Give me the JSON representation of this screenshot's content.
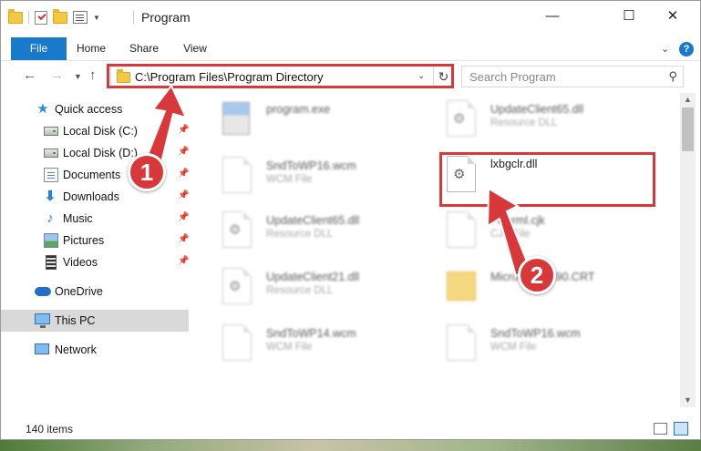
{
  "window": {
    "title": "Program",
    "controls": {
      "minimize": "—",
      "maximize": "☐",
      "close": "✕"
    }
  },
  "ribbon": {
    "tabs": [
      "File",
      "Home",
      "Share",
      "View"
    ],
    "help": "?"
  },
  "nav": {
    "address": "C:\\Program Files\\Program Directory",
    "search_placeholder": "Search Program"
  },
  "sidebar": {
    "quick_access": "Quick access",
    "items": [
      {
        "label": "Local Disk (C:)",
        "icon": "hard-disk-icon",
        "pinned": true
      },
      {
        "label": "Local Disk (D:)",
        "icon": "hard-disk-icon",
        "pinned": true
      },
      {
        "label": "Documents",
        "icon": "documents-icon",
        "pinned": true
      },
      {
        "label": "Downloads",
        "icon": "downloads-icon",
        "pinned": true
      },
      {
        "label": "Music",
        "icon": "music-icon",
        "pinned": true
      },
      {
        "label": "Pictures",
        "icon": "pictures-icon",
        "pinned": true
      },
      {
        "label": "Videos",
        "icon": "videos-icon",
        "pinned": true
      }
    ],
    "onedrive": "OneDrive",
    "this_pc": "This PC",
    "network": "Network"
  },
  "files": [
    {
      "name": "program.exe",
      "type": ""
    },
    {
      "name": "UpdateClient65.dll",
      "type": "Resource DLL"
    },
    {
      "name": "SndToWP16.wcm",
      "type": "WCM File"
    },
    {
      "name": "lxbgclr.dll",
      "type": ""
    },
    {
      "name": "UpdateClient65.dll",
      "type": "Resource DLL"
    },
    {
      "name": "Fwerml.cjk",
      "type": "CJK File"
    },
    {
      "name": "UpdateClient21.dll",
      "type": "Resource DLL"
    },
    {
      "name": "Microsoft.VC90.CRT",
      "type": ""
    },
    {
      "name": "SndToWP14.wcm",
      "type": "WCM File"
    },
    {
      "name": "SndToWP16.wcm",
      "type": "WCM File"
    }
  ],
  "status": {
    "item_count": "140 items"
  },
  "annotations": {
    "step1": "1",
    "step2": "2",
    "accent": "#d9383a"
  }
}
